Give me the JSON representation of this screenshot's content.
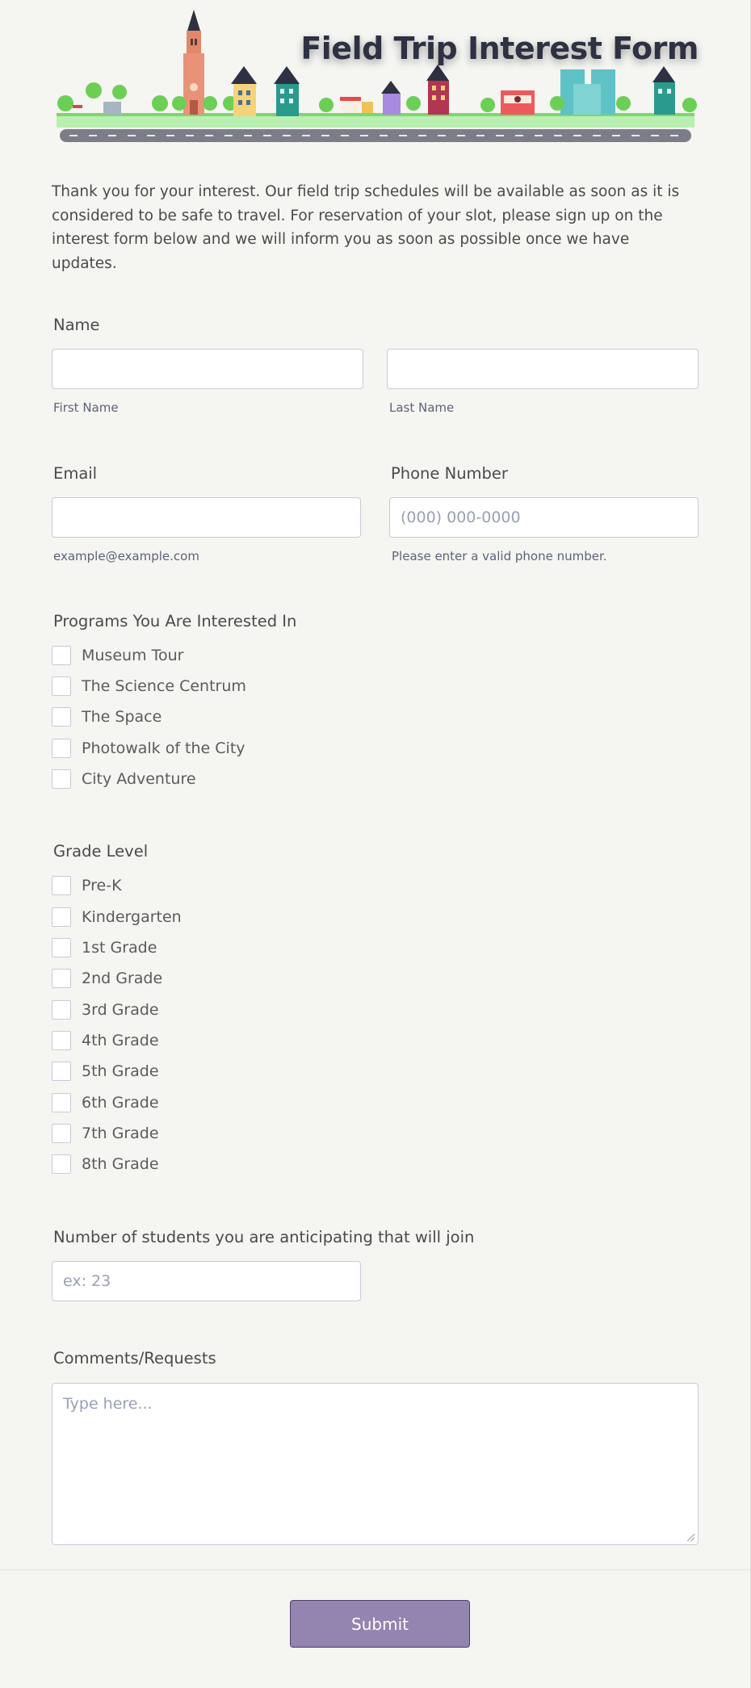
{
  "form": {
    "title": "Field Trip Interest Form",
    "intro": "Thank you for your interest. Our field trip schedules will be available as soon as it is considered to be safe to travel. For reservation of your slot, please sign up on the interest form below and we will inform you as soon as possible once we have updates."
  },
  "name": {
    "label": "Name",
    "first_value": "",
    "last_value": "",
    "first_sublabel": "First Name",
    "last_sublabel": "Last Name"
  },
  "email": {
    "label": "Email",
    "value": "",
    "sublabel": "example@example.com"
  },
  "phone": {
    "label": "Phone Number",
    "placeholder": "(000) 000-0000",
    "sublabel": "Please enter a valid phone number."
  },
  "programs": {
    "label": "Programs You Are Interested In",
    "options": [
      "Museum Tour",
      "The Science Centrum",
      "The Space",
      "Photowalk of the City",
      "City Adventure"
    ]
  },
  "grade": {
    "label": "Grade Level",
    "options": [
      "Pre-K",
      "Kindergarten",
      "1st Grade",
      "2nd Grade",
      "3rd Grade",
      "4th Grade",
      "5th Grade",
      "6th Grade",
      "7th Grade",
      "8th Grade"
    ]
  },
  "students": {
    "label": "Number of students you are anticipating that will join",
    "placeholder": "ex: 23"
  },
  "comments": {
    "label": "Comments/Requests",
    "placeholder": "Type here..."
  },
  "submit_label": "Submit"
}
